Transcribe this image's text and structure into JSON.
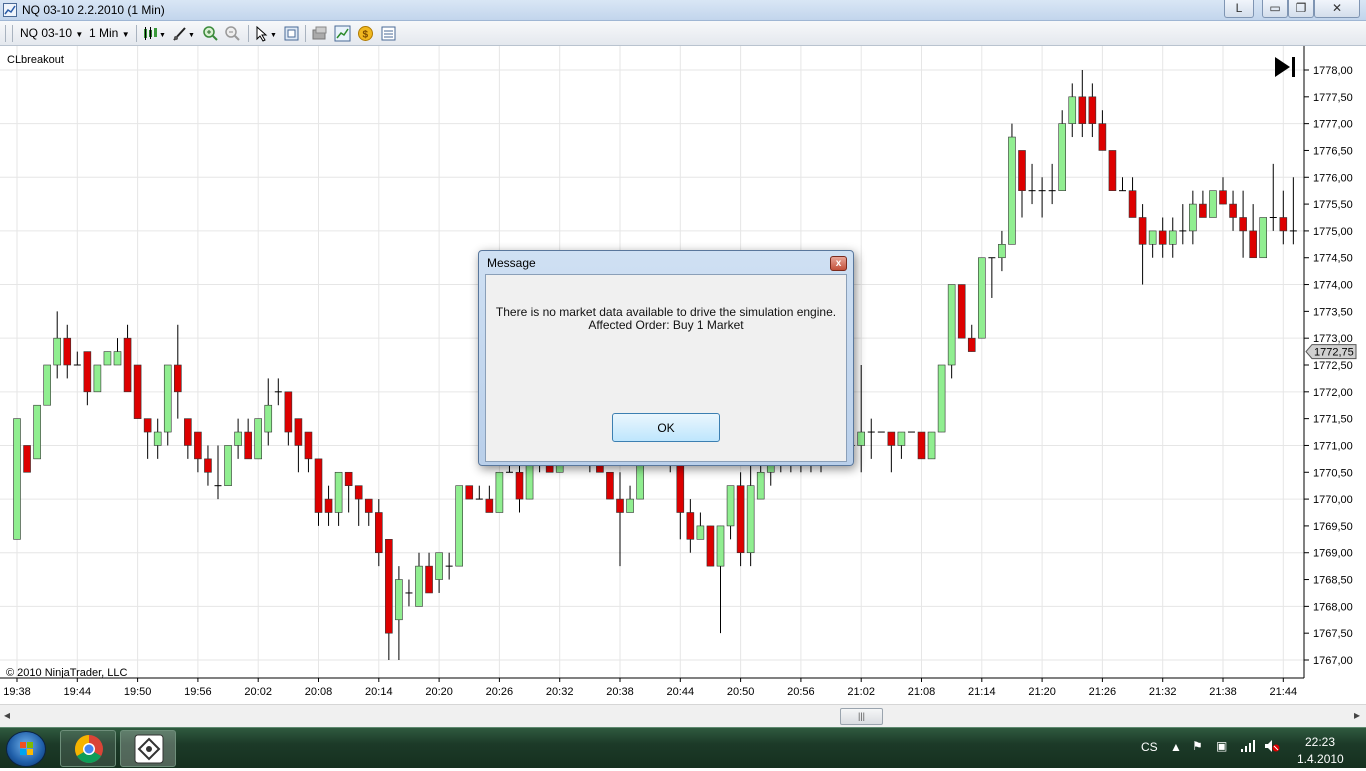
{
  "window": {
    "title": "NQ 03-10  2.2.2010 (1 Min)",
    "lang_button": "L",
    "minimize_glyph": "▭",
    "restore_glyph": "❐",
    "close_glyph": "✕"
  },
  "toolbar": {
    "instrument": "NQ 03-10",
    "interval": "1 Min",
    "icons": [
      "bar-type-icon",
      "drawing-tool-icon",
      "zoom-in-icon",
      "zoom-out-icon",
      "cursor-icon",
      "data-box-icon",
      "properties-icon",
      "indicators-icon",
      "strategies-icon",
      "chart-trader-icon"
    ]
  },
  "chart": {
    "label": "CLbreakout",
    "copyright": "© 2010 NinjaTrader, LLC",
    "play_to_end_icon": "▶|",
    "current_price_label": "1772,75",
    "y_ticks": [
      "1778,00",
      "1777,50",
      "1777,00",
      "1776,50",
      "1776,00",
      "1775,50",
      "1775,00",
      "1774,50",
      "1774,00",
      "1773,50",
      "1773,00",
      "1772,50",
      "1772,00",
      "1771,50",
      "1771,00",
      "1770,50",
      "1770,00",
      "1769,50",
      "1769,00",
      "1768,50",
      "1768,00",
      "1767,50",
      "1767,00"
    ],
    "x_ticks": [
      "19:38",
      "19:44",
      "19:50",
      "19:56",
      "20:02",
      "20:08",
      "20:14",
      "20:20",
      "20:26",
      "20:32",
      "20:38",
      "20:44",
      "20:50",
      "20:56",
      "21:02",
      "21:08",
      "21:14",
      "21:20",
      "21:26",
      "21:32",
      "21:38",
      "21:44"
    ],
    "colors": {
      "up": "#90ee90",
      "down": "#dd0000",
      "grid": "#e6e6e6",
      "wick": "#000000"
    }
  },
  "chart_data": {
    "type": "candlestick",
    "instrument": "NQ 03-10",
    "interval": "1 Min",
    "ylim": [
      1767.0,
      1778.0
    ],
    "start_time": "19:38",
    "candles": [
      [
        1769.25,
        1771.5,
        1769.25,
        1771.5
      ],
      [
        1771.0,
        1771.0,
        1770.5,
        1770.5
      ],
      [
        1770.75,
        1771.75,
        1770.75,
        1771.75
      ],
      [
        1771.75,
        1772.5,
        1771.75,
        1772.5
      ],
      [
        1772.5,
        1773.5,
        1772.25,
        1773.0
      ],
      [
        1773.0,
        1773.25,
        1772.25,
        1772.5
      ],
      [
        1772.5,
        1772.75,
        1772.5,
        1772.5
      ],
      [
        1772.75,
        1772.75,
        1771.75,
        1772.0
      ],
      [
        1772.0,
        1772.5,
        1772.0,
        1772.5
      ],
      [
        1772.5,
        1772.75,
        1772.5,
        1772.75
      ],
      [
        1772.5,
        1773.0,
        1772.5,
        1772.75
      ],
      [
        1773.0,
        1773.25,
        1772.0,
        1772.0
      ],
      [
        1772.5,
        1772.5,
        1771.5,
        1771.5
      ],
      [
        1771.5,
        1771.5,
        1770.75,
        1771.25
      ],
      [
        1771.0,
        1771.5,
        1770.75,
        1771.25
      ],
      [
        1771.25,
        1772.5,
        1771.0,
        1772.5
      ],
      [
        1772.5,
        1773.25,
        1771.5,
        1772.0
      ],
      [
        1771.5,
        1771.5,
        1770.75,
        1771.0
      ],
      [
        1771.25,
        1771.25,
        1770.5,
        1770.75
      ],
      [
        1770.75,
        1771.0,
        1770.25,
        1770.5
      ],
      [
        1770.25,
        1771.0,
        1770.0,
        1770.25
      ],
      [
        1770.25,
        1771.0,
        1770.25,
        1771.0
      ],
      [
        1771.0,
        1771.5,
        1770.75,
        1771.25
      ],
      [
        1771.25,
        1771.5,
        1770.75,
        1770.75
      ],
      [
        1770.75,
        1771.5,
        1770.75,
        1771.5
      ],
      [
        1771.25,
        1772.25,
        1771.0,
        1771.75
      ],
      [
        1772.0,
        1772.25,
        1771.75,
        1772.0
      ],
      [
        1772.0,
        1772.0,
        1771.0,
        1771.25
      ],
      [
        1771.5,
        1771.5,
        1770.5,
        1771.0
      ],
      [
        1771.25,
        1771.25,
        1770.5,
        1770.75
      ],
      [
        1770.75,
        1770.75,
        1769.5,
        1769.75
      ],
      [
        1770.0,
        1770.25,
        1769.5,
        1769.75
      ],
      [
        1769.75,
        1770.5,
        1769.5,
        1770.5
      ],
      [
        1770.5,
        1770.5,
        1769.75,
        1770.25
      ],
      [
        1770.25,
        1770.25,
        1769.5,
        1770.0
      ],
      [
        1770.0,
        1770.0,
        1769.5,
        1769.75
      ],
      [
        1769.75,
        1770.0,
        1768.75,
        1769.0
      ],
      [
        1769.25,
        1769.25,
        1767.0,
        1767.5
      ],
      [
        1767.75,
        1768.75,
        1767.0,
        1768.5
      ],
      [
        1768.25,
        1768.5,
        1768.0,
        1768.25
      ],
      [
        1768.0,
        1769.0,
        1768.0,
        1768.75
      ],
      [
        1768.75,
        1769.0,
        1768.25,
        1768.25
      ],
      [
        1768.5,
        1769.0,
        1768.25,
        1769.0
      ],
      [
        1768.75,
        1769.0,
        1768.5,
        1768.75
      ],
      [
        1768.75,
        1770.25,
        1768.75,
        1770.25
      ],
      [
        1770.25,
        1770.25,
        1770.0,
        1770.0
      ],
      [
        1770.0,
        1770.25,
        1770.0,
        1770.0
      ],
      [
        1770.0,
        1770.25,
        1769.75,
        1769.75
      ],
      [
        1769.75,
        1770.5,
        1769.75,
        1770.5
      ],
      [
        1770.5,
        1770.75,
        1770.5,
        1770.5
      ],
      [
        1770.5,
        1770.75,
        1769.75,
        1770.0
      ],
      [
        1770.0,
        1770.75,
        1770.0,
        1770.75
      ],
      [
        1770.75,
        1770.75,
        1770.5,
        1770.75
      ],
      [
        1770.75,
        1770.75,
        1770.5,
        1770.5
      ],
      [
        1770.5,
        1770.75,
        1770.5,
        1770.75
      ],
      [
        1770.75,
        1770.75,
        1770.75,
        1770.75
      ],
      [
        1770.75,
        1770.75,
        1770.75,
        1770.75
      ],
      [
        1770.75,
        1770.75,
        1770.5,
        1770.75
      ],
      [
        1770.75,
        1771.0,
        1770.5,
        1770.5
      ],
      [
        1770.5,
        1770.5,
        1770.0,
        1770.0
      ],
      [
        1770.0,
        1770.5,
        1768.75,
        1769.75
      ],
      [
        1769.75,
        1770.25,
        1769.75,
        1770.0
      ],
      [
        1770.0,
        1770.75,
        1770.0,
        1770.75
      ],
      [
        1770.75,
        1770.75,
        1770.75,
        1770.75
      ],
      [
        1770.75,
        1770.75,
        1770.75,
        1770.75
      ],
      [
        1770.75,
        1770.75,
        1770.5,
        1770.75
      ],
      [
        1770.75,
        1770.75,
        1769.25,
        1769.75
      ],
      [
        1769.75,
        1770.0,
        1769.0,
        1769.25
      ],
      [
        1769.25,
        1769.75,
        1769.25,
        1769.5
      ],
      [
        1769.5,
        1769.5,
        1768.75,
        1768.75
      ],
      [
        1768.75,
        1769.5,
        1767.5,
        1769.5
      ],
      [
        1769.5,
        1770.25,
        1769.25,
        1770.25
      ],
      [
        1770.25,
        1770.5,
        1768.75,
        1769.0
      ],
      [
        1769.0,
        1770.75,
        1768.75,
        1770.25
      ],
      [
        1770.0,
        1770.75,
        1770.0,
        1770.5
      ],
      [
        1770.5,
        1771.0,
        1770.25,
        1770.75
      ],
      [
        1770.75,
        1771.0,
        1770.5,
        1770.75
      ],
      [
        1770.75,
        1771.0,
        1770.5,
        1770.75
      ],
      [
        1770.75,
        1771.0,
        1770.5,
        1770.75
      ],
      [
        1770.75,
        1772.0,
        1770.5,
        1771.0
      ],
      [
        1771.0,
        1772.5,
        1770.5,
        1771.0
      ],
      [
        1771.0,
        1771.25,
        1770.75,
        1771.0
      ],
      [
        1771.0,
        1771.25,
        1770.75,
        1771.0
      ],
      [
        1771.0,
        1771.25,
        1770.75,
        1771.0
      ],
      [
        1771.0,
        1772.5,
        1770.5,
        1771.25
      ],
      [
        1771.25,
        1771.5,
        1770.75,
        1771.25
      ],
      [
        1771.25,
        1771.25,
        1771.25,
        1771.25
      ],
      [
        1771.25,
        1771.25,
        1770.5,
        1771.0
      ],
      [
        1771.0,
        1771.25,
        1770.75,
        1771.25
      ],
      [
        1771.25,
        1771.25,
        1771.25,
        1771.25
      ],
      [
        1771.25,
        1771.25,
        1770.75,
        1770.75
      ],
      [
        1770.75,
        1771.25,
        1770.75,
        1771.25
      ],
      [
        1771.25,
        1772.5,
        1771.25,
        1772.5
      ],
      [
        1772.5,
        1774.0,
        1772.25,
        1774.0
      ],
      [
        1774.0,
        1774.0,
        1773.0,
        1773.0
      ],
      [
        1773.0,
        1773.25,
        1772.75,
        1772.75
      ],
      [
        1773.0,
        1774.5,
        1773.0,
        1774.5
      ],
      [
        1774.5,
        1774.5,
        1773.75,
        1774.5
      ],
      [
        1774.5,
        1775.0,
        1774.25,
        1774.75
      ],
      [
        1774.75,
        1777.0,
        1774.75,
        1776.75
      ],
      [
        1776.5,
        1776.5,
        1775.25,
        1775.75
      ],
      [
        1775.75,
        1776.25,
        1775.5,
        1775.75
      ],
      [
        1775.75,
        1776.0,
        1775.25,
        1775.75
      ],
      [
        1775.75,
        1776.25,
        1775.5,
        1775.75
      ],
      [
        1775.75,
        1777.25,
        1775.75,
        1777.0
      ],
      [
        1777.0,
        1777.75,
        1776.75,
        1777.5
      ],
      [
        1777.5,
        1778.0,
        1776.75,
        1777.0
      ],
      [
        1777.5,
        1777.75,
        1776.75,
        1777.0
      ],
      [
        1777.0,
        1777.25,
        1776.5,
        1776.5
      ],
      [
        1776.5,
        1776.5,
        1775.75,
        1775.75
      ],
      [
        1775.75,
        1776.0,
        1775.75,
        1775.75
      ],
      [
        1775.75,
        1776.0,
        1775.25,
        1775.25
      ],
      [
        1775.25,
        1775.5,
        1774.0,
        1774.75
      ],
      [
        1774.75,
        1775.0,
        1774.5,
        1775.0
      ],
      [
        1775.0,
        1775.25,
        1774.5,
        1774.75
      ],
      [
        1774.75,
        1775.25,
        1774.5,
        1775.0
      ],
      [
        1775.0,
        1775.5,
        1774.75,
        1775.0
      ],
      [
        1775.0,
        1775.75,
        1774.75,
        1775.5
      ],
      [
        1775.5,
        1775.75,
        1775.25,
        1775.25
      ],
      [
        1775.25,
        1775.75,
        1775.25,
        1775.75
      ],
      [
        1775.75,
        1776.0,
        1775.5,
        1775.5
      ],
      [
        1775.5,
        1775.75,
        1775.0,
        1775.25
      ],
      [
        1775.25,
        1775.75,
        1774.5,
        1775.0
      ],
      [
        1775.0,
        1775.5,
        1774.75,
        1774.5
      ],
      [
        1774.5,
        1775.25,
        1774.5,
        1775.25
      ],
      [
        1775.25,
        1776.25,
        1775.0,
        1775.25
      ],
      [
        1775.25,
        1775.75,
        1774.75,
        1775.0
      ],
      [
        1775.0,
        1776.0,
        1774.75,
        1775.0
      ],
      [
        1775.25,
        1775.25,
        1773.75,
        1773.75
      ],
      [
        1773.75,
        1774.0,
        1773.25,
        1773.5
      ],
      [
        1773.5,
        1774.0,
        1773.0,
        1773.75
      ],
      [
        1773.75,
        1773.75,
        1772.5,
        1772.75
      ]
    ]
  },
  "dialog": {
    "title": "Message",
    "line1": "There is no market data available to drive the simulation engine.",
    "line2": "Affected Order: Buy 1 Market",
    "ok_label": "OK",
    "close_glyph": "x"
  },
  "scrollbar": {
    "thumb_glyph": "|||",
    "left_arrow": "◂",
    "right_arrow": "▸"
  },
  "taskbar": {
    "lang": "CS",
    "time": "22:23",
    "date": "1.4.2010",
    "apps": [
      "chrome-icon",
      "ninjatrader-icon"
    ]
  }
}
